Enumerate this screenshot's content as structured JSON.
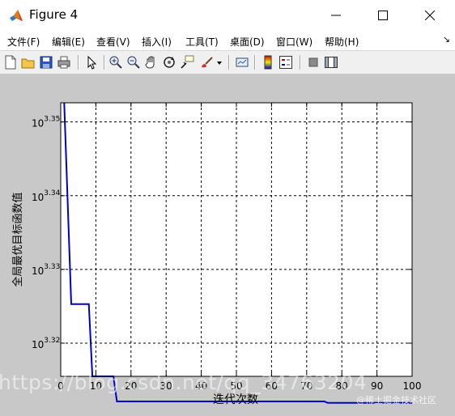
{
  "window": {
    "title": "Figure 4",
    "minimize_glyph": "—",
    "maximize_glyph": "☐",
    "close_glyph": "✕"
  },
  "menu": {
    "items": [
      {
        "label": "文件(F)"
      },
      {
        "label": "编辑(E)"
      },
      {
        "label": "查看(V)"
      },
      {
        "label": "插入(I)"
      },
      {
        "label": "工具(T)"
      },
      {
        "label": "桌面(D)"
      },
      {
        "label": "窗口(W)"
      },
      {
        "label": "帮助(H)"
      }
    ],
    "dock_glyph": "↘"
  },
  "toolbar": {
    "icons": [
      "new-figure-icon",
      "open-file-icon",
      "save-icon",
      "print-icon",
      "pointer-icon",
      "zoom-in-icon",
      "zoom-out-icon",
      "pan-icon",
      "rotate-3d-icon",
      "data-cursor-icon",
      "brush-icon",
      "brush-dropdown-icon",
      "link-plot-icon",
      "colorbar-icon",
      "legend-icon",
      "hide-plot-tools-icon",
      "show-plot-tools-icon"
    ]
  },
  "chart_data": {
    "type": "line",
    "title": "",
    "xlabel": "迭代次数",
    "ylabel": "全局最优目标函数值",
    "xscale": "linear",
    "yscale": "log",
    "xlim": [
      0,
      100
    ],
    "ylim_exponent": [
      3.3155,
      3.3526
    ],
    "x_ticks": [
      "0",
      "10",
      "20",
      "30",
      "40",
      "50",
      "60",
      "70",
      "80",
      "90",
      "100"
    ],
    "y_ticks": [
      {
        "base": "10",
        "exp": "3.32",
        "value": 3.32
      },
      {
        "base": "10",
        "exp": "3.33",
        "value": 3.33
      },
      {
        "base": "10",
        "exp": "3.34",
        "value": 3.34
      },
      {
        "base": "10",
        "exp": "3.35",
        "value": 3.35
      }
    ],
    "grid": true,
    "line_color": "#0000cc",
    "series": [
      {
        "x": [
          1,
          3,
          3,
          8,
          9,
          15,
          16,
          75,
          76,
          100
        ],
        "y_exponent": [
          3.3526,
          3.3253,
          3.3253,
          3.3253,
          3.3155,
          3.3155,
          3.3121,
          3.3121,
          3.3119,
          3.3119
        ]
      }
    ]
  },
  "watermark": {
    "text": "https://blog.csdn.net/qq_34763204",
    "subtext": "@稀土掘金技术社区"
  }
}
